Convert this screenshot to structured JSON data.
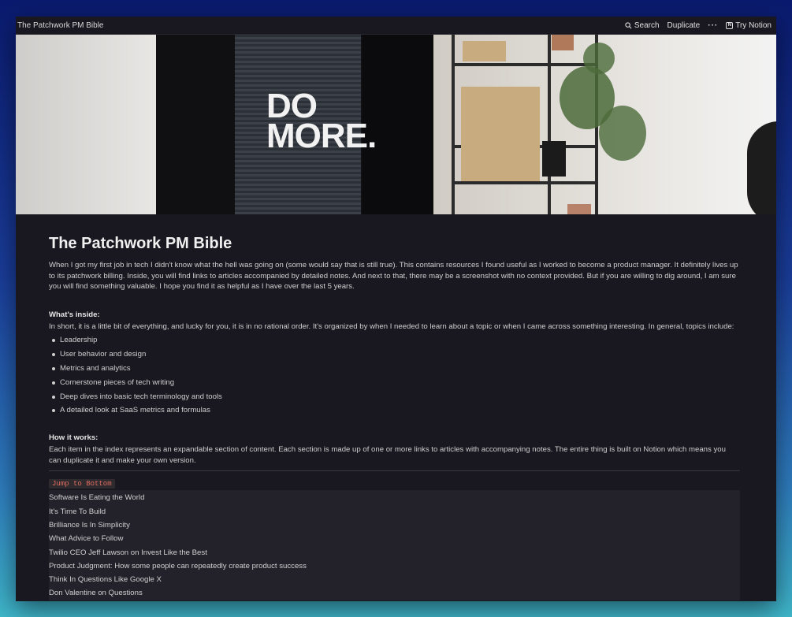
{
  "topbar": {
    "title": "The Patchwork PM Bible",
    "search_label": "Search",
    "duplicate_label": "Duplicate",
    "more_label": "···",
    "try_notion_label": "Try Notion"
  },
  "cover": {
    "sign_line1": "DO",
    "sign_line2": "MORE."
  },
  "page": {
    "title": "The Patchwork PM Bible",
    "intro": "When I got my first job in tech I didn't know what the hell was going on (some would say that is still true). This contains resources I found useful as I worked to become a product manager. It definitely lives up to its patchwork billing. Inside, you will find links to articles accompanied by detailed notes. And next to that, there may be a screenshot with no context provided. But if you are willing to dig around, I am sure you will find something valuable. I hope you find it as helpful as I have over the last 5 years.",
    "whats_inside_heading": "What's inside:",
    "whats_inside_text": "In short, it is a little bit of everything, and lucky for you, it is in no rational order. It's organized by when I needed to learn about a topic or when I came across something interesting. In general, topics include:",
    "topics": [
      "Leadership",
      "User behavior and design",
      "Metrics and analytics",
      "Cornerstone pieces of tech writing",
      "Deep dives into basic tech terminology and tools",
      "A detailed look at SaaS metrics and formulas"
    ],
    "how_heading": "How it works:",
    "how_text": "Each item in the index represents an expandable section of content. Each section is made up of one or more links to articles with accompanying notes. The entire thing is built on Notion which means you can duplicate it and make your own version.",
    "jump_label": "Jump to Bottom",
    "index_items": [
      "Software Is Eating the World",
      "It's Time To Build",
      "Brilliance Is In Simplicity",
      "What Advice to Follow",
      "Twilio CEO Jeff Lawson on Invest Like the Best",
      "Product Judgment: How some people can repeatedly create product success",
      "Think In Questions Like Google X",
      "Don Valentine on Questions"
    ]
  }
}
